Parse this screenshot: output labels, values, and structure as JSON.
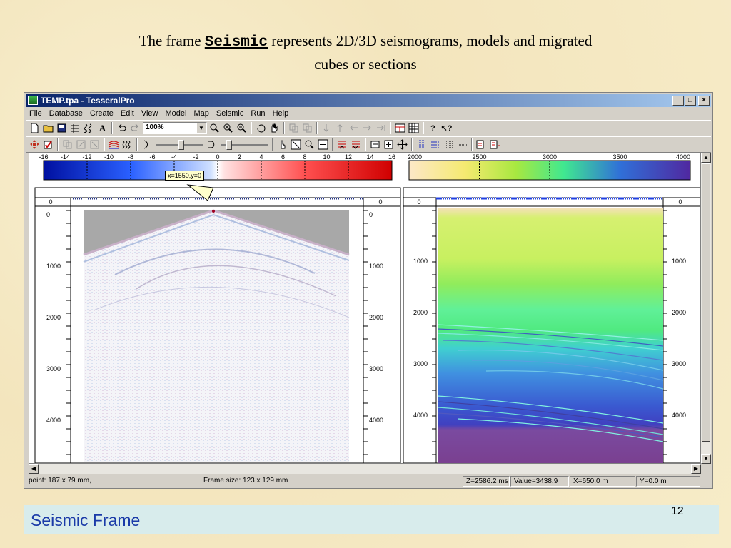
{
  "slide": {
    "title_prefix": "The frame",
    "title_keyword": "Seismic",
    "title_line1_rest": "represents 2D/3D seismograms, models and migrated",
    "title_line2": "cubes or sections",
    "footer_label": "Seismic Frame",
    "slide_number": "12"
  },
  "window": {
    "title": "TEMP.tpa - TesseralPro",
    "buttons": [
      "_",
      "□",
      "×"
    ]
  },
  "menu": [
    "File",
    "Database",
    "Create",
    "Edit",
    "View",
    "Model",
    "Map",
    "Seismic",
    "Run",
    "Help"
  ],
  "toolbar": {
    "zoom_value": "100%"
  },
  "seismic_panel": {
    "colorbar_ticks": [
      "-16",
      "-14",
      "-12",
      "-10",
      "-8",
      "-6",
      "-4",
      "-2",
      "0",
      "2",
      "4",
      "6",
      "8",
      "10",
      "12",
      "14",
      "16"
    ],
    "top_label_left": "0",
    "top_label_right": "0",
    "depth_ticks": [
      "0",
      "1000",
      "2000",
      "3000",
      "4000"
    ],
    "tooltip": "x=1550,y=0"
  },
  "model_panel": {
    "colorbar_ticks": [
      "2000",
      "2500",
      "3000",
      "3500",
      "4000"
    ],
    "top_label_left": "0",
    "top_label_right": "0",
    "depth_ticks": [
      "1000",
      "2000",
      "3000",
      "4000"
    ]
  },
  "status": {
    "point": "point: 187 x 79 mm,",
    "frame_size": "Frame size: 123 x 129 mm",
    "z": "Z=2586.2 ms",
    "value": "Value=3438.9",
    "x": "X=650.0 m",
    "y": "Y=0.0 m"
  },
  "colors": {
    "title_bar": "#0a246a",
    "footer_text": "#1a3aa8",
    "footer_bg": "#d8ecec"
  }
}
